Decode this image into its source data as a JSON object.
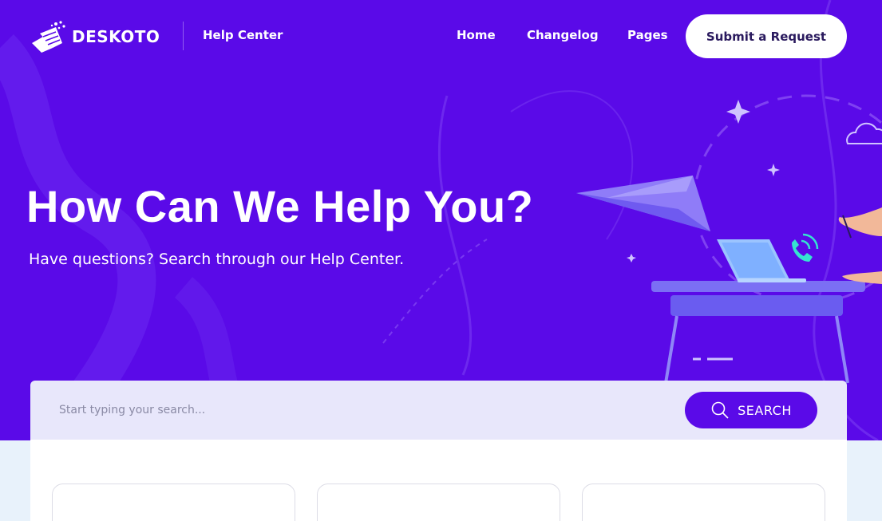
{
  "brand": {
    "name": "DESKOTO"
  },
  "header": {
    "section_link": "Help Center",
    "nav": [
      {
        "label": "Home"
      },
      {
        "label": "Changelog"
      },
      {
        "label": "Pages"
      }
    ],
    "cta_label": "Submit a Request"
  },
  "hero": {
    "title": "How Can We Help You?",
    "subtitle": "Have questions? Search through our Help Center."
  },
  "search": {
    "placeholder": "Start typing your search...",
    "button_label": "SEARCH"
  },
  "colors": {
    "hero_background": "#5a0ae8",
    "page_background": "#e8f2fb",
    "search_bar": "#e8e7fb",
    "accent": "#5a0ae8"
  },
  "icons": [
    "logo-icon",
    "search-icon",
    "paper-plane-illustration",
    "phone-icon",
    "cloud-icon",
    "sparkle-icon"
  ]
}
